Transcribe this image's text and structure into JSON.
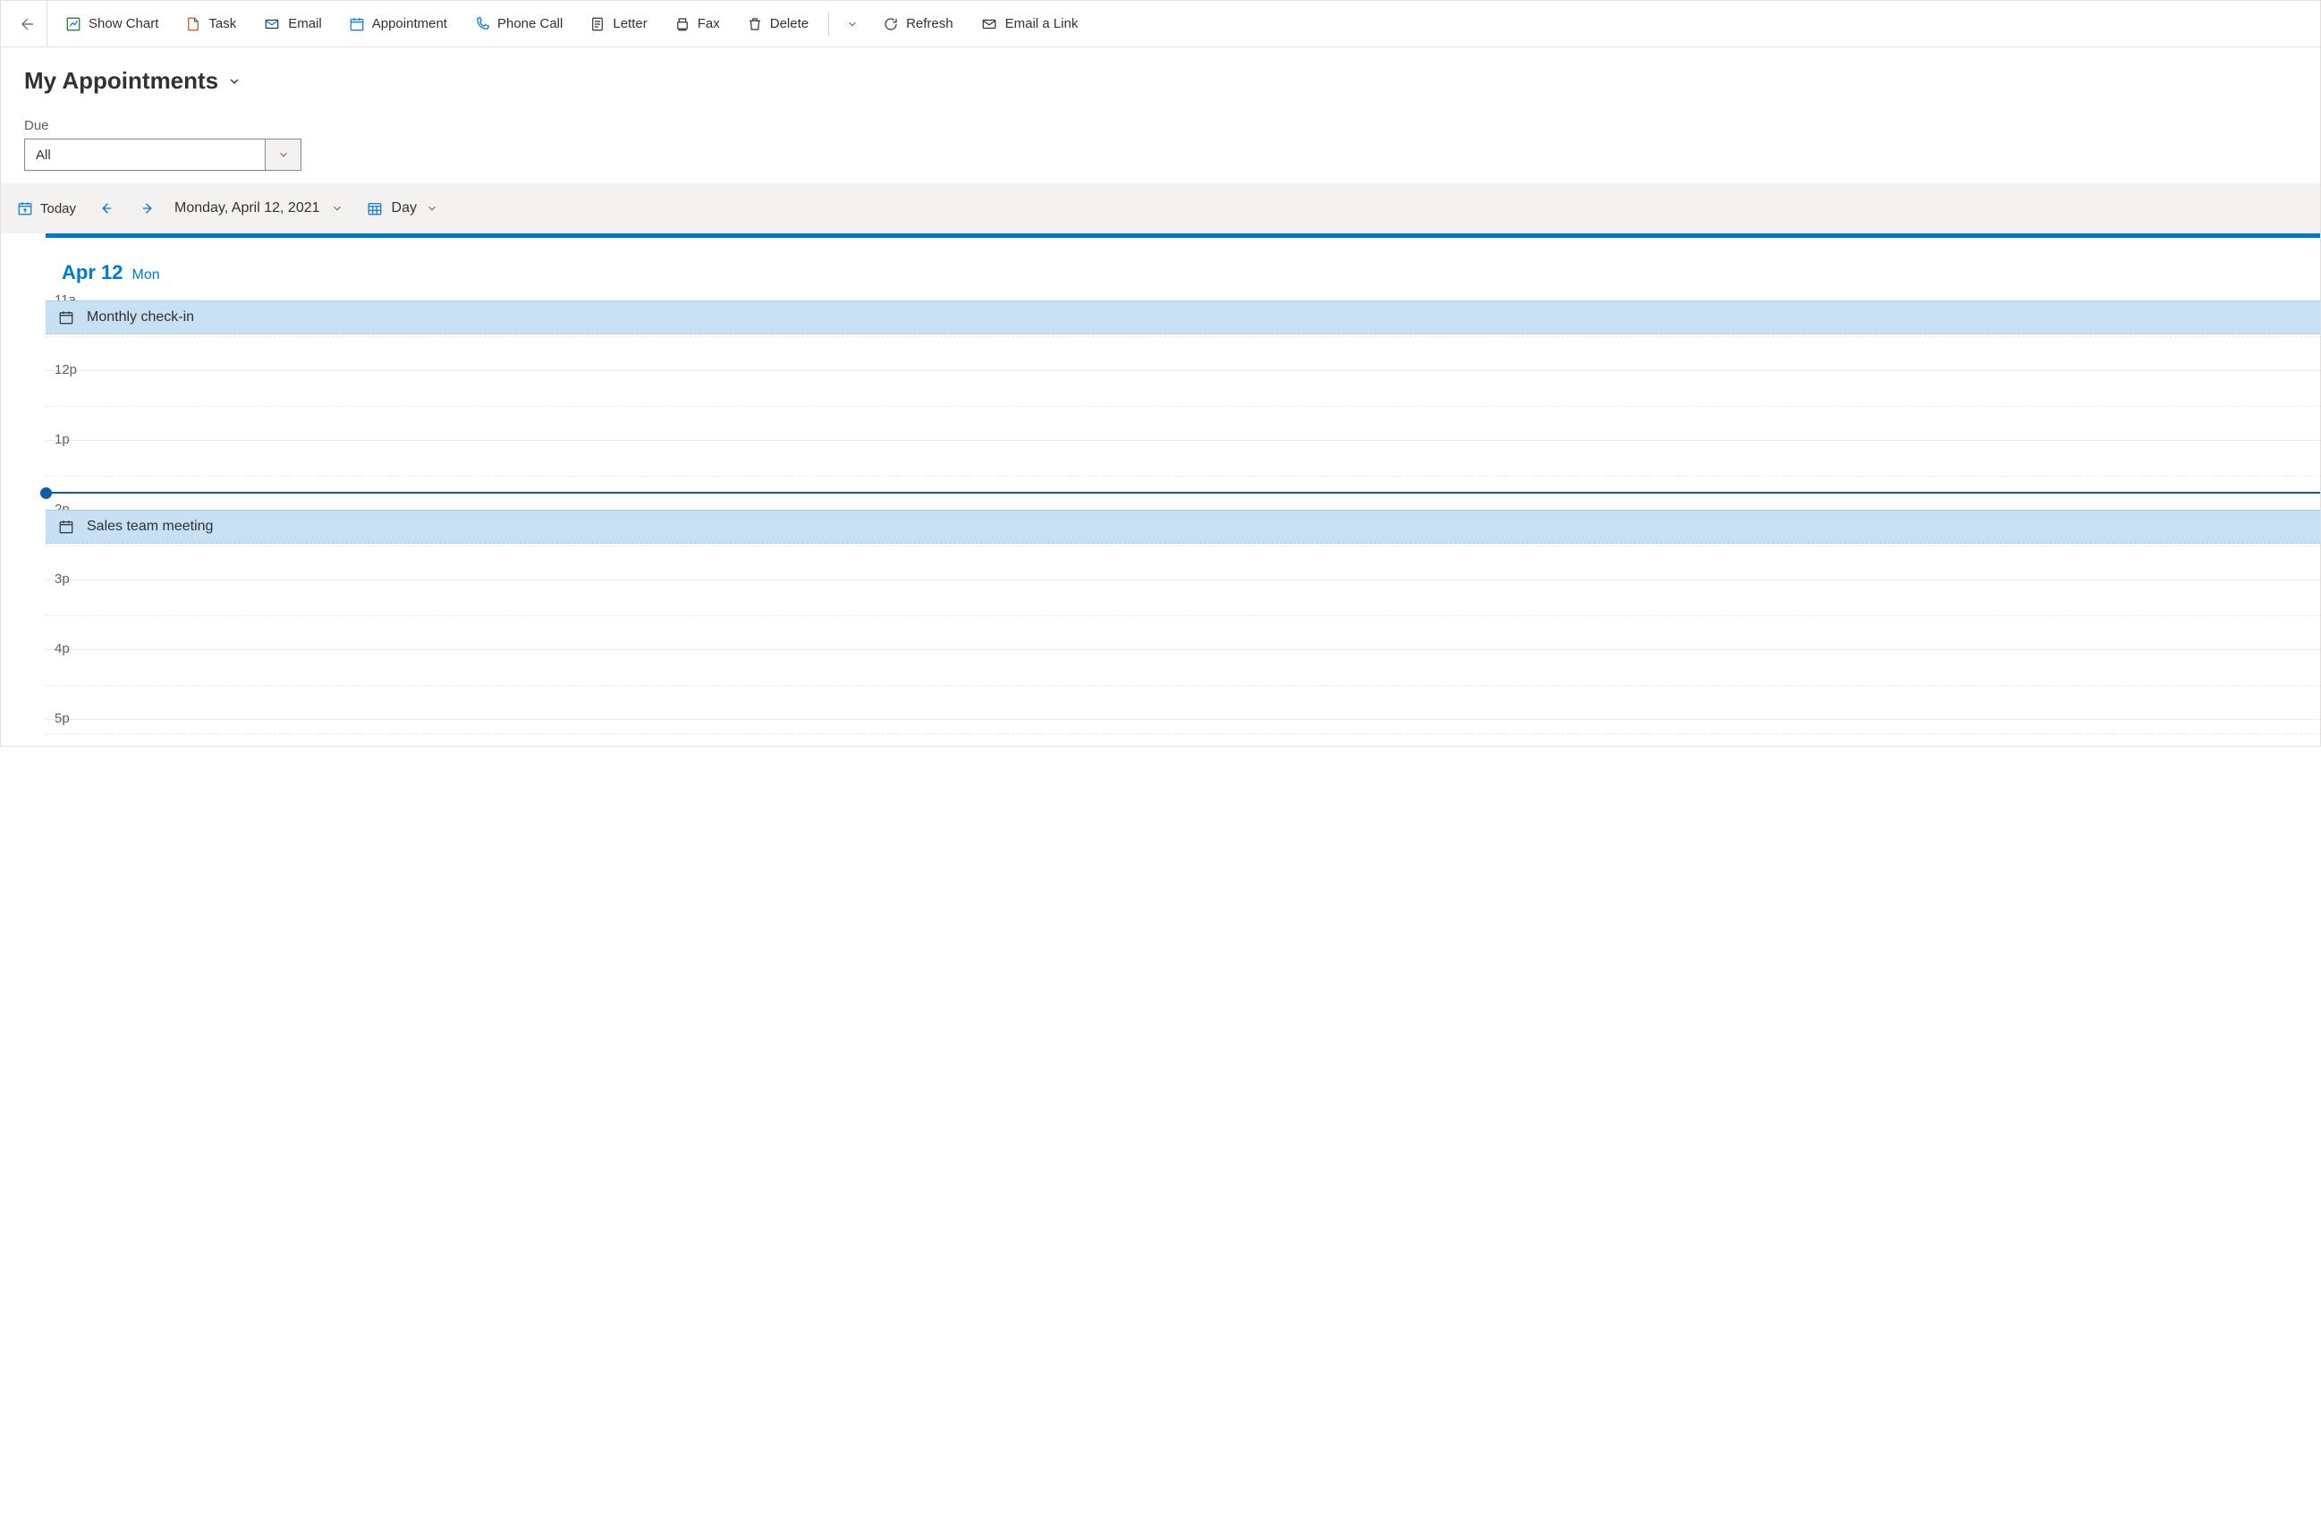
{
  "toolbar": {
    "show_chart": "Show Chart",
    "task": "Task",
    "email": "Email",
    "appointment": "Appointment",
    "phone_call": "Phone Call",
    "letter": "Letter",
    "fax": "Fax",
    "delete": "Delete",
    "refresh": "Refresh",
    "email_link": "Email a Link"
  },
  "view": {
    "title": "My Appointments"
  },
  "filter": {
    "label": "Due",
    "value": "All"
  },
  "datebar": {
    "today": "Today",
    "date_label": "Monday, April 12, 2021",
    "view_mode": "Day"
  },
  "dayhead": {
    "date": "Apr 12",
    "day": "Mon"
  },
  "hours": [
    "11a",
    "12p",
    "1p",
    "2p",
    "3p",
    "4p",
    "5p"
  ],
  "events": [
    {
      "title": "Monthly check-in"
    },
    {
      "title": "Sales team meeting"
    }
  ]
}
